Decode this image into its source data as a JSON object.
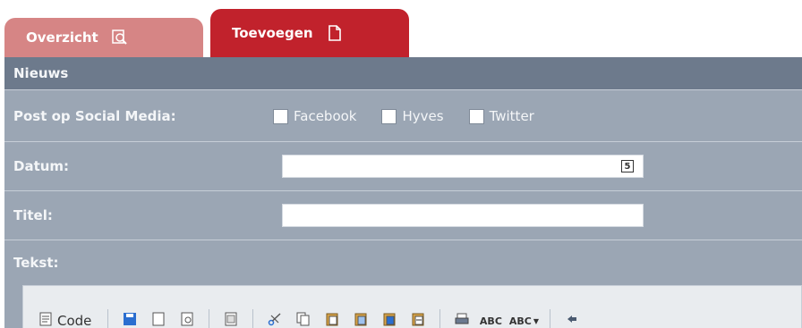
{
  "tabs": [
    {
      "label": "Overzicht",
      "icon": "magnifier-document-icon"
    },
    {
      "label": "Toevoegen",
      "icon": "new-document-icon"
    }
  ],
  "section_title": "Nieuws",
  "form": {
    "social_label": "Post op Social Media:",
    "social_options": [
      "Facebook",
      "Hyves",
      "Twitter"
    ],
    "date_label": "Datum:",
    "date_value": "",
    "title_label": "Titel:",
    "title_value": "",
    "text_label": "Tekst:"
  },
  "toolbar": {
    "code_label": "Code",
    "spell_label": "ABC",
    "spell_dropdown_label": "ABC"
  },
  "colors": {
    "tab_inactive": "#d68585",
    "tab_active": "#c1222c",
    "panel_bg": "#9ba6b4",
    "header_bg": "#6d7a8c"
  }
}
